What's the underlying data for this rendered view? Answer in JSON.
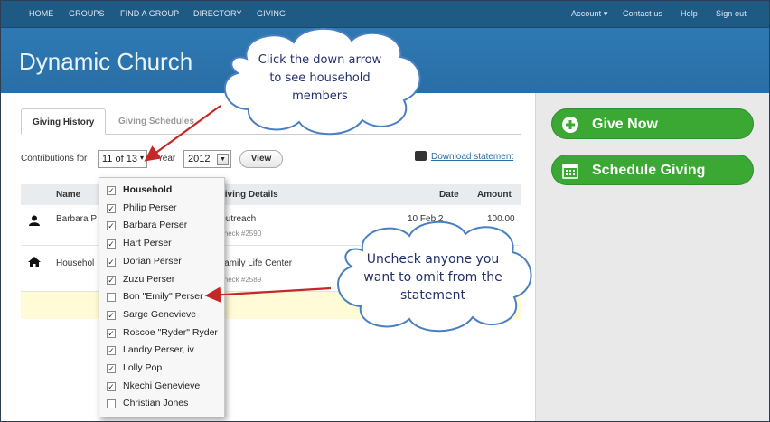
{
  "nav": {
    "left": [
      "HOME",
      "GROUPS",
      "FIND A GROUP",
      "DIRECTORY",
      "GIVING"
    ],
    "account": "Account",
    "right": [
      "Contact us",
      "Help",
      "Sign out"
    ]
  },
  "brand": "Dynamic Church",
  "tabs": [
    "Giving History",
    "Giving Schedules"
  ],
  "filters": {
    "contributions_label": "Contributions for",
    "members_value": "11 of 13",
    "year_label": "Year",
    "year_value": "2012",
    "view_label": "View",
    "download_label": "Download statement"
  },
  "table": {
    "headers": {
      "name": "Name",
      "details": "Giving Details",
      "date": "Date",
      "amount": "Amount"
    },
    "rows": [
      {
        "name": "Barbara P",
        "detail": "Outreach",
        "sub": "Check #2590",
        "date": "10 Feb 2",
        "amount": "100.00"
      },
      {
        "name": "Househol",
        "detail": "Family Life Center",
        "sub": "Check #2589",
        "date": "",
        "amount": ""
      }
    ]
  },
  "dropdown": {
    "items": [
      {
        "label": "Household",
        "checked": "✓"
      },
      {
        "label": "Philip Perser",
        "checked": "✓"
      },
      {
        "label": "Barbara Perser",
        "checked": "✓"
      },
      {
        "label": "Hart Perser",
        "checked": "✓"
      },
      {
        "label": "Dorian Perser",
        "checked": "✓"
      },
      {
        "label": "Zuzu Perser",
        "checked": "✓"
      },
      {
        "label": "Bon \"Emily\" Perser",
        "checked": ""
      },
      {
        "label": "Sarge Genevieve",
        "checked": "✓"
      },
      {
        "label": "Roscoe \"Ryder\" Ryder",
        "checked": "✓"
      },
      {
        "label": "Landry Perser, iv",
        "checked": "✓"
      },
      {
        "label": "Lolly Pop",
        "checked": "✓"
      },
      {
        "label": "Nkechi Genevieve",
        "checked": "✓"
      },
      {
        "label": "Christian Jones",
        "checked": ""
      }
    ]
  },
  "buttons": {
    "give_now": "Give Now",
    "schedule": "Schedule Giving"
  },
  "callouts": {
    "top": [
      "Click the down arrow",
      "to see household",
      "members"
    ],
    "bottom": [
      "Uncheck anyone you",
      "want to omit from the",
      "statement"
    ]
  },
  "colors": {
    "nav": "#1f5a85",
    "banner": "#2e79b3",
    "green": "#3aa832",
    "arrow": "#c62828",
    "callout_text": "#23306b"
  }
}
